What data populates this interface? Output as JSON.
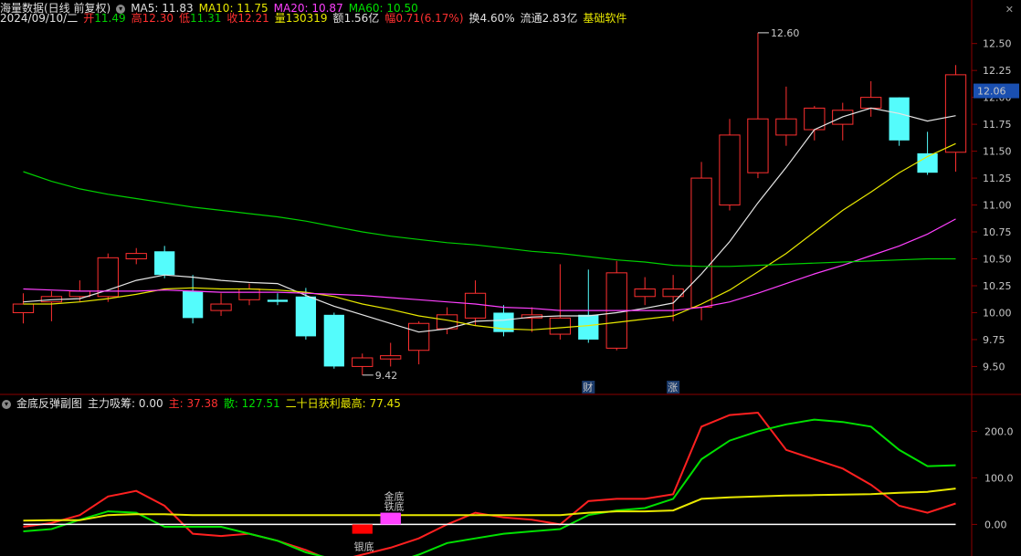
{
  "header": {
    "title": "海量数据(日线 前复权)",
    "ma": [
      {
        "label": "MA5: 11.83",
        "color": "#e0e0e0"
      },
      {
        "label": "MA10: 11.75",
        "color": "#e8e800"
      },
      {
        "label": "MA20: 10.87",
        "color": "#ff40ff"
      },
      {
        "label": "MA60: 10.50",
        "color": "#00e000"
      }
    ],
    "info": {
      "date": "2024/09/10/二",
      "open_label": "开",
      "open": "11.49",
      "high_label": "高",
      "high": "12.30",
      "low_label": "低",
      "low": "11.31",
      "close_label": "收",
      "close": "12.21",
      "vol_label": "量",
      "vol": "130319",
      "amt_label": "额",
      "amt": "1.56亿",
      "chg_label": "幅",
      "chg": "0.71(6.17%)",
      "turn": "换4.60%",
      "float": "流通2.83亿",
      "concept": "基础软件"
    }
  },
  "sub_header": {
    "title": "金底反弹副图",
    "absorb": "主力吸筹: 0.00",
    "main_label": "主: ",
    "main_val": "37.38",
    "retail_label": "散: ",
    "retail_val": "127.51",
    "profit_label": "二十日获利最高: ",
    "profit_val": "77.45"
  },
  "chart_data": [
    {
      "type": "candlestick",
      "title": "海量数据(日线 前复权)",
      "ylim": [
        9.3,
        12.65
      ],
      "y_ticks": [
        9.5,
        9.75,
        10.0,
        10.25,
        10.5,
        10.75,
        11.0,
        11.25,
        11.5,
        11.75,
        12.0,
        12.25,
        12.5
      ],
      "y_tick_labels": [
        "9.50",
        "9.75",
        "10.00",
        "10.25",
        "10.50",
        "10.75",
        "11.00",
        "11.25",
        "11.50",
        "11.75",
        "12.00",
        "12.25",
        "12.50"
      ],
      "current_price": "12.06",
      "candles": [
        {
          "o": 10.0,
          "h": 10.18,
          "l": 9.9,
          "c": 10.08
        },
        {
          "o": 10.1,
          "h": 10.2,
          "l": 9.92,
          "c": 10.15
        },
        {
          "o": 10.15,
          "h": 10.3,
          "l": 10.1,
          "c": 10.2
        },
        {
          "o": 10.15,
          "h": 10.55,
          "l": 10.1,
          "c": 10.51
        },
        {
          "o": 10.5,
          "h": 10.6,
          "l": 10.45,
          "c": 10.55
        },
        {
          "o": 10.57,
          "h": 10.62,
          "l": 10.32,
          "c": 10.35
        },
        {
          "o": 10.2,
          "h": 10.35,
          "l": 9.9,
          "c": 9.95
        },
        {
          "o": 10.02,
          "h": 10.18,
          "l": 9.97,
          "c": 10.08
        },
        {
          "o": 10.12,
          "h": 10.27,
          "l": 10.07,
          "c": 10.22
        },
        {
          "o": 10.12,
          "h": 10.18,
          "l": 10.07,
          "c": 10.1
        },
        {
          "o": 10.15,
          "h": 10.23,
          "l": 9.75,
          "c": 9.78
        },
        {
          "o": 9.98,
          "h": 10.0,
          "l": 9.48,
          "c": 9.5
        },
        {
          "o": 9.5,
          "h": 9.62,
          "l": 9.42,
          "c": 9.58
        },
        {
          "o": 9.57,
          "h": 9.72,
          "l": 9.5,
          "c": 9.6
        },
        {
          "o": 9.65,
          "h": 9.92,
          "l": 9.52,
          "c": 9.9
        },
        {
          "o": 9.85,
          "h": 10.05,
          "l": 9.8,
          "c": 9.98
        },
        {
          "o": 9.95,
          "h": 10.3,
          "l": 9.88,
          "c": 10.18
        },
        {
          "o": 10.0,
          "h": 10.07,
          "l": 9.78,
          "c": 9.82
        },
        {
          "o": 9.95,
          "h": 10.05,
          "l": 9.82,
          "c": 9.98
        },
        {
          "o": 9.8,
          "h": 10.45,
          "l": 9.75,
          "c": 9.95
        },
        {
          "o": 9.98,
          "h": 10.4,
          "l": 9.72,
          "c": 9.75
        },
        {
          "o": 9.67,
          "h": 10.48,
          "l": 9.65,
          "c": 10.37
        },
        {
          "o": 10.15,
          "h": 10.33,
          "l": 10.07,
          "c": 10.22
        },
        {
          "o": 10.15,
          "h": 10.35,
          "l": 9.92,
          "c": 10.22
        },
        {
          "o": 10.05,
          "h": 11.4,
          "l": 9.93,
          "c": 11.25
        },
        {
          "o": 11.0,
          "h": 11.8,
          "l": 10.95,
          "c": 11.65
        },
        {
          "o": 11.3,
          "h": 12.6,
          "l": 11.25,
          "c": 11.8
        },
        {
          "o": 11.65,
          "h": 12.1,
          "l": 11.55,
          "c": 11.8
        },
        {
          "o": 11.7,
          "h": 11.92,
          "l": 11.6,
          "c": 11.9
        },
        {
          "o": 11.75,
          "h": 11.95,
          "l": 11.6,
          "c": 11.88
        },
        {
          "o": 11.9,
          "h": 12.15,
          "l": 11.82,
          "c": 12.0
        },
        {
          "o": 12.0,
          "h": 12.0,
          "l": 11.55,
          "c": 11.6
        },
        {
          "o": 11.48,
          "h": 11.68,
          "l": 11.28,
          "c": 11.3
        },
        {
          "o": 11.49,
          "h": 12.3,
          "l": 11.31,
          "c": 12.21
        }
      ],
      "series": [
        {
          "name": "MA5",
          "color": "#e6e6e6",
          "values": [
            10.1,
            10.12,
            10.13,
            10.21,
            10.3,
            10.35,
            10.33,
            10.3,
            10.28,
            10.27,
            10.16,
            10.06,
            9.98,
            9.9,
            9.82,
            9.85,
            9.92,
            9.93,
            9.96,
            9.97,
            9.97,
            10.0,
            10.04,
            10.09,
            10.36,
            10.66,
            11.02,
            11.35,
            11.7,
            11.82,
            11.9,
            11.85,
            11.78,
            11.83
          ]
        },
        {
          "name": "MA10",
          "color": "#e8e800",
          "values": [
            10.08,
            10.08,
            10.1,
            10.13,
            10.17,
            10.22,
            10.23,
            10.22,
            10.22,
            10.21,
            10.19,
            10.15,
            10.08,
            10.03,
            9.97,
            9.93,
            9.88,
            9.85,
            9.84,
            9.86,
            9.88,
            9.91,
            9.94,
            9.97,
            10.08,
            10.21,
            10.38,
            10.55,
            10.75,
            10.95,
            11.12,
            11.3,
            11.45,
            11.57
          ]
        },
        {
          "name": "MA20",
          "color": "#ff40ff",
          "values": [
            10.22,
            10.21,
            10.2,
            10.2,
            10.2,
            10.21,
            10.2,
            10.19,
            10.19,
            10.19,
            10.18,
            10.17,
            10.16,
            10.14,
            10.12,
            10.1,
            10.08,
            10.05,
            10.04,
            10.02,
            10.02,
            10.02,
            10.02,
            10.02,
            10.05,
            10.1,
            10.18,
            10.27,
            10.36,
            10.44,
            10.53,
            10.62,
            10.73,
            10.87
          ]
        },
        {
          "name": "MA60",
          "color": "#00d000",
          "values": [
            11.31,
            11.22,
            11.15,
            11.1,
            11.06,
            11.02,
            10.98,
            10.95,
            10.92,
            10.89,
            10.85,
            10.8,
            10.75,
            10.71,
            10.68,
            10.65,
            10.63,
            10.6,
            10.57,
            10.55,
            10.52,
            10.49,
            10.47,
            10.44,
            10.43,
            10.43,
            10.44,
            10.45,
            10.46,
            10.47,
            10.48,
            10.49,
            10.5,
            10.5
          ]
        }
      ],
      "annotations": [
        {
          "text": "12.60",
          "index": 26,
          "value": 12.6
        },
        {
          "text": "9.42",
          "index": 12,
          "value": 9.42
        }
      ],
      "markers": [
        {
          "text": "财",
          "index": 20
        },
        {
          "text": "涨",
          "index": 23
        }
      ]
    },
    {
      "type": "line",
      "title": "金底反弹副图",
      "ylim": [
        -60,
        240
      ],
      "y_ticks": [
        0,
        100,
        200
      ],
      "y_tick_labels": [
        "0.00",
        "100.0",
        "200.0"
      ],
      "series": [
        {
          "name": "主",
          "color": "#ff2020",
          "values": [
            -5,
            3,
            20,
            60,
            72,
            40,
            -20,
            -25,
            -20,
            -35,
            -55,
            -80,
            -65,
            -50,
            -30,
            0,
            25,
            15,
            10,
            0,
            50,
            55,
            55,
            65,
            210,
            235,
            240,
            160,
            140,
            120,
            85,
            40,
            25,
            45
          ]
        },
        {
          "name": "散",
          "color": "#00e000",
          "values": [
            -15,
            -10,
            10,
            28,
            25,
            -5,
            -5,
            -5,
            -20,
            -35,
            -60,
            -75,
            -80,
            -85,
            -65,
            -40,
            -30,
            -20,
            -15,
            -10,
            20,
            30,
            35,
            55,
            140,
            180,
            200,
            215,
            225,
            220,
            210,
            160,
            125,
            127
          ]
        },
        {
          "name": "二十日获利最高",
          "color": "#e8e800",
          "values": [
            8,
            9,
            9,
            20,
            22,
            22,
            20,
            20,
            20,
            20,
            20,
            20,
            20,
            20,
            20,
            20,
            20,
            20,
            20,
            20,
            25,
            28,
            28,
            30,
            55,
            58,
            60,
            62,
            63,
            64,
            65,
            68,
            70,
            77
          ]
        },
        {
          "name": "base",
          "color": "#ffffff",
          "values": [
            0,
            0,
            0,
            0,
            0,
            0,
            0,
            0,
            0,
            0,
            0,
            0,
            0,
            0,
            0,
            0,
            0,
            0,
            0,
            0,
            0,
            0,
            0,
            0,
            0,
            0,
            0,
            0,
            0,
            0,
            0,
            0,
            0,
            0
          ]
        }
      ],
      "signals": [
        {
          "text": "银底",
          "index": 12,
          "color": "#ff0000",
          "label_color": "#ff3030",
          "low": -20,
          "high": 0
        },
        {
          "text": "金底",
          "index": 13,
          "color": "#ff40ff",
          "label_color": "#e8e800",
          "low": 0,
          "high": 25
        },
        {
          "text": "铁底",
          "index": 13,
          "color": "#ff40ff",
          "label_color": "#ff40ff",
          "low": 0,
          "high": 25
        }
      ]
    }
  ]
}
